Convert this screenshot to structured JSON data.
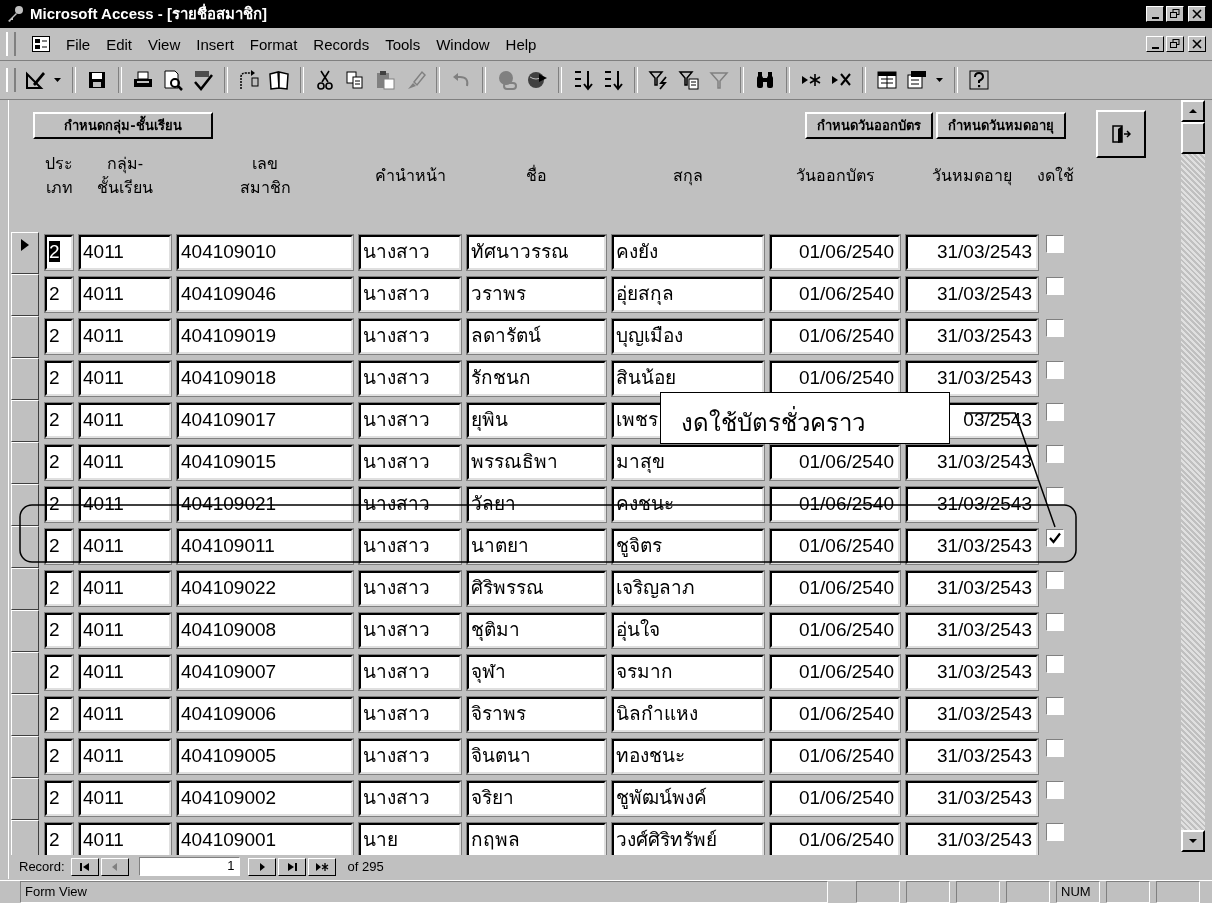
{
  "window": {
    "title": "Microsoft Access - [รายชื่อสมาชิก]"
  },
  "menu": [
    {
      "label": "File"
    },
    {
      "label": "Edit"
    },
    {
      "label": "View"
    },
    {
      "label": "Insert"
    },
    {
      "label": "Format"
    },
    {
      "label": "Records"
    },
    {
      "label": "Tools"
    },
    {
      "label": "Window"
    },
    {
      "label": "Help"
    }
  ],
  "form": {
    "buttons": [
      {
        "label": "กำหนดกลุ่ม-ชั้นเรียน"
      },
      {
        "label": "กำหนดวันออกบัตร"
      },
      {
        "label": "กำหนดวันหมดอายุ"
      }
    ],
    "columns": [
      {
        "lines": [
          "ประ",
          "เภท"
        ]
      },
      {
        "lines": [
          "กลุ่ม-",
          "ชั้นเรียน"
        ]
      },
      {
        "lines": [
          "เลข",
          "สมาชิก"
        ]
      },
      {
        "lines": [
          "คำนำหน้า"
        ]
      },
      {
        "lines": [
          "ชื่อ"
        ]
      },
      {
        "lines": [
          "สกุล"
        ]
      },
      {
        "lines": [
          "วันออกบัตร"
        ]
      },
      {
        "lines": [
          "วันหมดอายุ"
        ]
      },
      {
        "lines": [
          "งดใช้"
        ]
      }
    ],
    "rows": [
      {
        "selected": true,
        "type": "2",
        "group": "4011",
        "member_id": "404109010",
        "prefix": "นางสาว",
        "first_name": "ทัศนาวรรณ",
        "surname": "คงยัง",
        "issued": "01/06/2540",
        "expires": "31/03/2543",
        "suspended": false
      },
      {
        "selected": false,
        "type": "2",
        "group": "4011",
        "member_id": "404109046",
        "prefix": "นางสาว",
        "first_name": "วราพร",
        "surname": "อุ่ยสกุล",
        "issued": "01/06/2540",
        "expires": "31/03/2543",
        "suspended": false
      },
      {
        "selected": false,
        "type": "2",
        "group": "4011",
        "member_id": "404109019",
        "prefix": "นางสาว",
        "first_name": "ลดารัตน์",
        "surname": "บุญเมือง",
        "issued": "01/06/2540",
        "expires": "31/03/2543",
        "suspended": false
      },
      {
        "selected": false,
        "type": "2",
        "group": "4011",
        "member_id": "404109018",
        "prefix": "นางสาว",
        "first_name": "รักชนก",
        "surname": "สินน้อย",
        "issued": "01/06/2540",
        "expires": "31/03/2543",
        "suspended": false
      },
      {
        "selected": false,
        "type": "2",
        "group": "4011",
        "member_id": "404109017",
        "prefix": "นางสาว",
        "first_name": "ยุพิน",
        "surname": "เพชร",
        "expires": "03/2543",
        "suspended": false
      },
      {
        "selected": false,
        "type": "2",
        "group": "4011",
        "member_id": "404109015",
        "prefix": "นางสาว",
        "first_name": "พรรณธิพา",
        "surname": "มาสุข",
        "issued": "01/06/2540",
        "expires": "31/03/2543",
        "suspended": false
      },
      {
        "selected": false,
        "type": "2",
        "group": "4011",
        "member_id": "404109021",
        "prefix": "นางสาว",
        "first_name": "วัลยา",
        "surname": "คงชนะ",
        "issued": "01/06/2540",
        "expires": "31/03/2543",
        "suspended": false
      },
      {
        "selected": false,
        "type": "2",
        "group": "4011",
        "member_id": "404109011",
        "prefix": "นางสาว",
        "first_name": "นาตยา",
        "surname": "ชูจิตร",
        "issued": "01/06/2540",
        "expires": "31/03/2543",
        "suspended": true
      },
      {
        "selected": false,
        "type": "2",
        "group": "4011",
        "member_id": "404109022",
        "prefix": "นางสาว",
        "first_name": "ศิริพรรณ",
        "surname": "เจริญลาภ",
        "issued": "01/06/2540",
        "expires": "31/03/2543",
        "suspended": false
      },
      {
        "selected": false,
        "type": "2",
        "group": "4011",
        "member_id": "404109008",
        "prefix": "นางสาว",
        "first_name": "ชุติมา",
        "surname": "อุ่นใจ",
        "issued": "01/06/2540",
        "expires": "31/03/2543",
        "suspended": false
      },
      {
        "selected": false,
        "type": "2",
        "group": "4011",
        "member_id": "404109007",
        "prefix": "นางสาว",
        "first_name": "จุฬา",
        "surname": "จรมาก",
        "issued": "01/06/2540",
        "expires": "31/03/2543",
        "suspended": false
      },
      {
        "selected": false,
        "type": "2",
        "group": "4011",
        "member_id": "404109006",
        "prefix": "นางสาว",
        "first_name": "จิราพร",
        "surname": "นิลกำแหง",
        "issued": "01/06/2540",
        "expires": "31/03/2543",
        "suspended": false
      },
      {
        "selected": false,
        "type": "2",
        "group": "4011",
        "member_id": "404109005",
        "prefix": "นางสาว",
        "first_name": "จินตนา",
        "surname": "ทองชนะ",
        "issued": "01/06/2540",
        "expires": "31/03/2543",
        "suspended": false
      },
      {
        "selected": false,
        "type": "2",
        "group": "4011",
        "member_id": "404109002",
        "prefix": "นางสาว",
        "first_name": "จริยา",
        "surname": "ชูพัฒน์พงค์",
        "issued": "01/06/2540",
        "expires": "31/03/2543",
        "suspended": false
      },
      {
        "selected": false,
        "type": "2",
        "group": "4011",
        "member_id": "404109001",
        "prefix": "นาย",
        "first_name": "กฤพล",
        "surname": "วงศ์ศิริทรัพย์",
        "issued": "01/06/2540",
        "expires": "31/03/2543",
        "suspended": false
      }
    ]
  },
  "record_nav": {
    "label": "Record:",
    "current": "1",
    "total": "of 295"
  },
  "callout": {
    "text": "งดใช้บัตรชั่วคราว"
  },
  "status_bar": {
    "text": "Form View",
    "indicators": [
      {
        "text": "NUM"
      }
    ]
  }
}
